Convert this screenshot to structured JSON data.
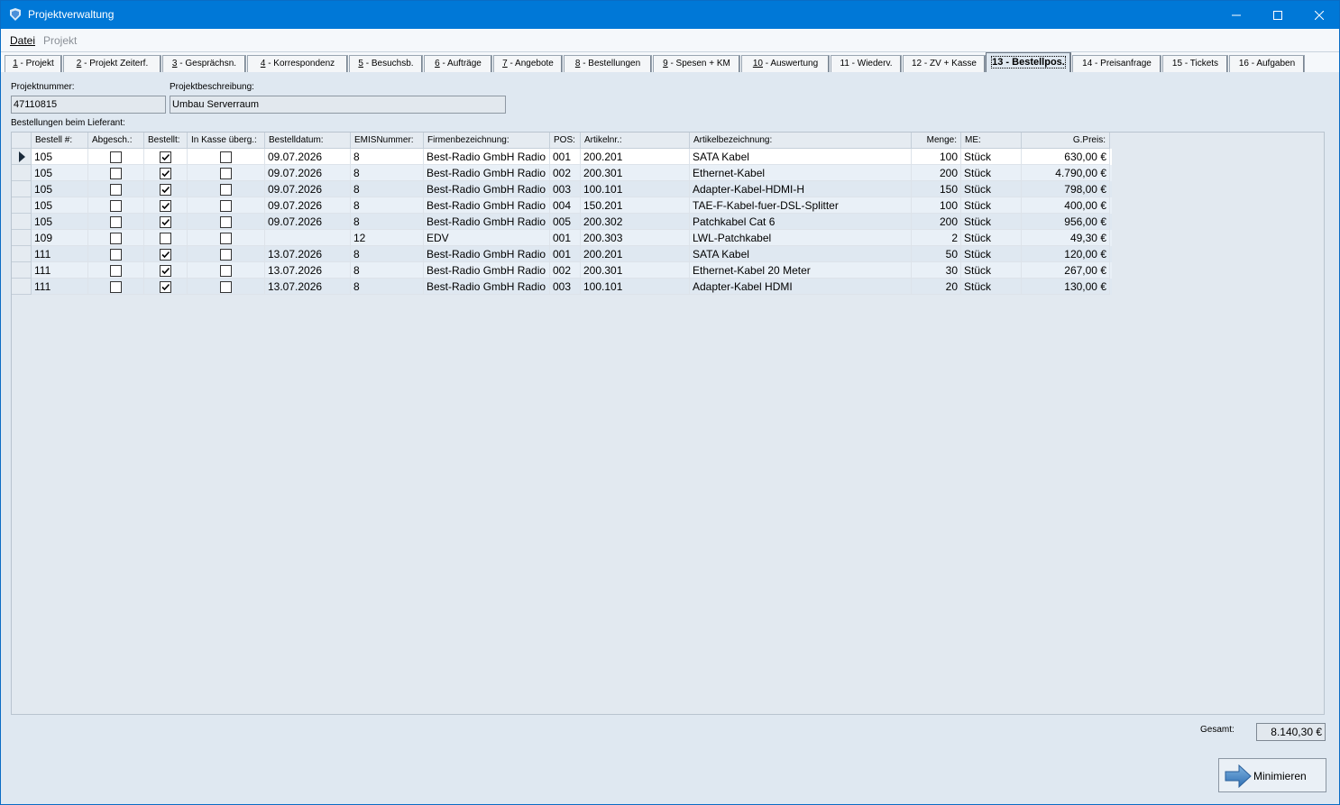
{
  "window": {
    "title": "Projektverwaltung"
  },
  "menu": [
    {
      "label": "Datei",
      "enabled": true
    },
    {
      "label": "Projekt",
      "enabled": false
    }
  ],
  "tabs": [
    {
      "key": "1",
      "label": " - Projekt"
    },
    {
      "key": "2",
      "label": " - Projekt Zeiterf."
    },
    {
      "key": "3",
      "label": " - Gesprächsn."
    },
    {
      "key": "4",
      "label": " - Korrespondenz"
    },
    {
      "key": "5",
      "label": " - Besuchsb."
    },
    {
      "key": "6",
      "label": " - Aufträge"
    },
    {
      "key": "7",
      "label": " - Angebote"
    },
    {
      "key": "8",
      "label": " - Bestellungen"
    },
    {
      "key": "9",
      "label": " - Spesen + KM"
    },
    {
      "key": "10",
      "label": " - Auswertung"
    },
    {
      "key": "",
      "label": "11 - Wiederv."
    },
    {
      "key": "",
      "label": "12 - ZV + Kasse"
    },
    {
      "key": "",
      "label": "13 - Bestellpos."
    },
    {
      "key": "",
      "label": "14 - Preisanfrage"
    },
    {
      "key": "",
      "label": "15 - Tickets"
    },
    {
      "key": "",
      "label": "16 - Aufgaben"
    }
  ],
  "active_tab": "13 - Bestellpos.",
  "project": {
    "nummer_label": "Projektnummer:",
    "nummer": "47110815",
    "beschreibung_label": "Projektbeschreibung:",
    "beschreibung": "Umbau Serverraum"
  },
  "grid": {
    "caption": "Bestellungen beim Lieferant:",
    "columns": [
      "Bestell #:",
      "Abgesch.:",
      "Bestellt:",
      "In Kasse überg.:",
      "Bestelldatum:",
      "EMISNummer:",
      "Firmenbezeichnung:",
      "POS:",
      "Artikelnr.:",
      "Artikelbezeichnung:",
      "Menge:",
      "ME:",
      "G.Preis:"
    ],
    "rows": [
      {
        "bestell": "105",
        "abgesch": false,
        "bestellt": true,
        "kasse": false,
        "datum": "09.07.2026",
        "emis": "8",
        "firma": "Best-Radio GmbH Radio",
        "pos": "001",
        "artikelnr": "200.201",
        "bezeichnung": "SATA Kabel",
        "menge": "100",
        "me": "Stück",
        "preis": "630,00 €",
        "current": true
      },
      {
        "bestell": "105",
        "abgesch": false,
        "bestellt": true,
        "kasse": false,
        "datum": "09.07.2026",
        "emis": "8",
        "firma": "Best-Radio GmbH Radio",
        "pos": "002",
        "artikelnr": "200.301",
        "bezeichnung": "Ethernet-Kabel",
        "menge": "200",
        "me": "Stück",
        "preis": "4.790,00 €",
        "current": false
      },
      {
        "bestell": "105",
        "abgesch": false,
        "bestellt": true,
        "kasse": false,
        "datum": "09.07.2026",
        "emis": "8",
        "firma": "Best-Radio GmbH Radio",
        "pos": "003",
        "artikelnr": "100.101",
        "bezeichnung": "Adapter-Kabel-HDMI-H",
        "menge": "150",
        "me": "Stück",
        "preis": "798,00 €",
        "current": false
      },
      {
        "bestell": "105",
        "abgesch": false,
        "bestellt": true,
        "kasse": false,
        "datum": "09.07.2026",
        "emis": "8",
        "firma": "Best-Radio GmbH Radio",
        "pos": "004",
        "artikelnr": "150.201",
        "bezeichnung": "TAE-F-Kabel-fuer-DSL-Splitter",
        "menge": "100",
        "me": "Stück",
        "preis": "400,00 €",
        "current": false
      },
      {
        "bestell": "105",
        "abgesch": false,
        "bestellt": true,
        "kasse": false,
        "datum": "09.07.2026",
        "emis": "8",
        "firma": "Best-Radio GmbH Radio",
        "pos": "005",
        "artikelnr": "200.302",
        "bezeichnung": "Patchkabel Cat 6",
        "menge": "200",
        "me": "Stück",
        "preis": "956,00 €",
        "current": false
      },
      {
        "bestell": "109",
        "abgesch": false,
        "bestellt": false,
        "kasse": false,
        "datum": "",
        "emis": "12",
        "firma": "EDV",
        "pos": "001",
        "artikelnr": "200.303",
        "bezeichnung": "LWL-Patchkabel",
        "menge": "2",
        "me": "Stück",
        "preis": "49,30 €",
        "current": false
      },
      {
        "bestell": "111",
        "abgesch": false,
        "bestellt": true,
        "kasse": false,
        "datum": "13.07.2026",
        "emis": "8",
        "firma": "Best-Radio GmbH Radio",
        "pos": "001",
        "artikelnr": "200.201",
        "bezeichnung": "SATA Kabel",
        "menge": "50",
        "me": "Stück",
        "preis": "120,00 €",
        "current": false
      },
      {
        "bestell": "111",
        "abgesch": false,
        "bestellt": true,
        "kasse": false,
        "datum": "13.07.2026",
        "emis": "8",
        "firma": "Best-Radio GmbH Radio",
        "pos": "002",
        "artikelnr": "200.301",
        "bezeichnung": "Ethernet-Kabel 20 Meter",
        "menge": "30",
        "me": "Stück",
        "preis": "267,00 €",
        "current": false
      },
      {
        "bestell": "111",
        "abgesch": false,
        "bestellt": true,
        "kasse": false,
        "datum": "13.07.2026",
        "emis": "8",
        "firma": "Best-Radio GmbH Radio",
        "pos": "003",
        "artikelnr": "100.101",
        "bezeichnung": "Adapter-Kabel HDMI",
        "menge": "20",
        "me": "Stück",
        "preis": "130,00 €",
        "current": false
      }
    ]
  },
  "footer": {
    "gesamt_label": "Gesamt:",
    "gesamt_value": "8.140,30 €",
    "minimize_label": "Minimieren"
  },
  "icons": {
    "app": "app-logo-icon",
    "minimize": "window-minimize-icon",
    "maximize": "window-maximize-icon",
    "close": "window-close-icon",
    "row_pointer": "row-pointer-icon",
    "minimize_button": "arrow-right-icon"
  },
  "colors": {
    "titlebar": "#0078d7",
    "background": "#dfe8f1",
    "row_alt": "#e9f0f7",
    "row_current": "#ffffff"
  }
}
